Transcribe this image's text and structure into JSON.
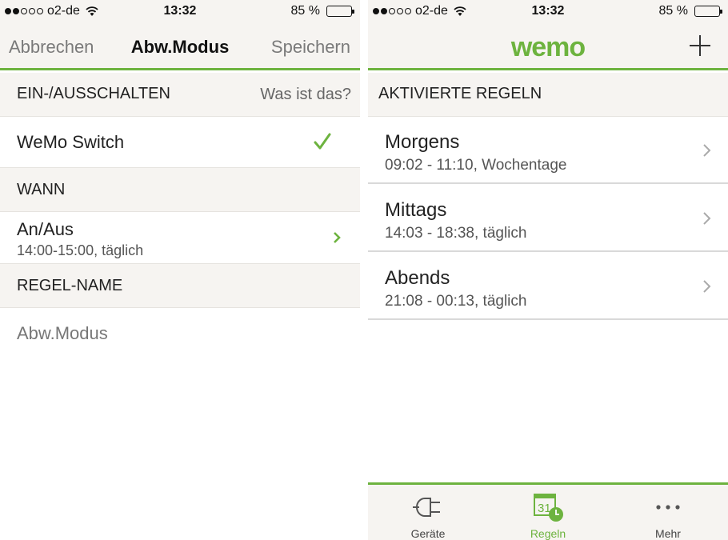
{
  "colors": {
    "accent": "#6db33f",
    "bar_bg": "#f6f4f1",
    "text": "#222222",
    "muted": "#7a7a7a"
  },
  "left": {
    "status": {
      "carrier": "o2-de",
      "time": "13:32",
      "battery": "85 %",
      "signal_filled": 2,
      "signal_total": 5,
      "battery_level": 0.85
    },
    "nav": {
      "cancel": "Abbrechen",
      "title": "Abw.Modus",
      "save": "Speichern"
    },
    "section_onoff": {
      "label": "EIN-/AUSSCHALTEN",
      "help": "Was ist das?"
    },
    "device": {
      "name": "WeMo Switch",
      "icon": "checkmark-icon"
    },
    "section_when": {
      "label": "WANN"
    },
    "schedule": {
      "title": "An/Aus",
      "detail": "14:00-15:00, täglich",
      "icon": "chevron-right-icon"
    },
    "section_name": {
      "label": "REGEL-NAME"
    },
    "rule_name": {
      "value": "Abw.Modus"
    }
  },
  "right": {
    "status": {
      "carrier": "o2-de",
      "time": "13:32",
      "battery": "85 %",
      "signal_filled": 2,
      "signal_total": 5,
      "battery_level": 0.85
    },
    "header": {
      "logo": "wemo",
      "add_icon": "plus-icon"
    },
    "section": {
      "label": "AKTIVIERTE REGELN"
    },
    "rules": [
      {
        "title": "Morgens",
        "detail": "09:02 - 11:10, Wochentage"
      },
      {
        "title": "Mittags",
        "detail": "14:03 - 18:38, täglich"
      },
      {
        "title": "Abends",
        "detail": "21:08 - 00:13, täglich"
      }
    ],
    "tabs": [
      {
        "label": "Geräte",
        "icon": "plug-icon",
        "active": false
      },
      {
        "label": "Regeln",
        "icon": "calendar-clock-icon",
        "calendar_day": "31",
        "active": true
      },
      {
        "label": "Mehr",
        "icon": "more-dots-icon",
        "active": false
      }
    ]
  }
}
